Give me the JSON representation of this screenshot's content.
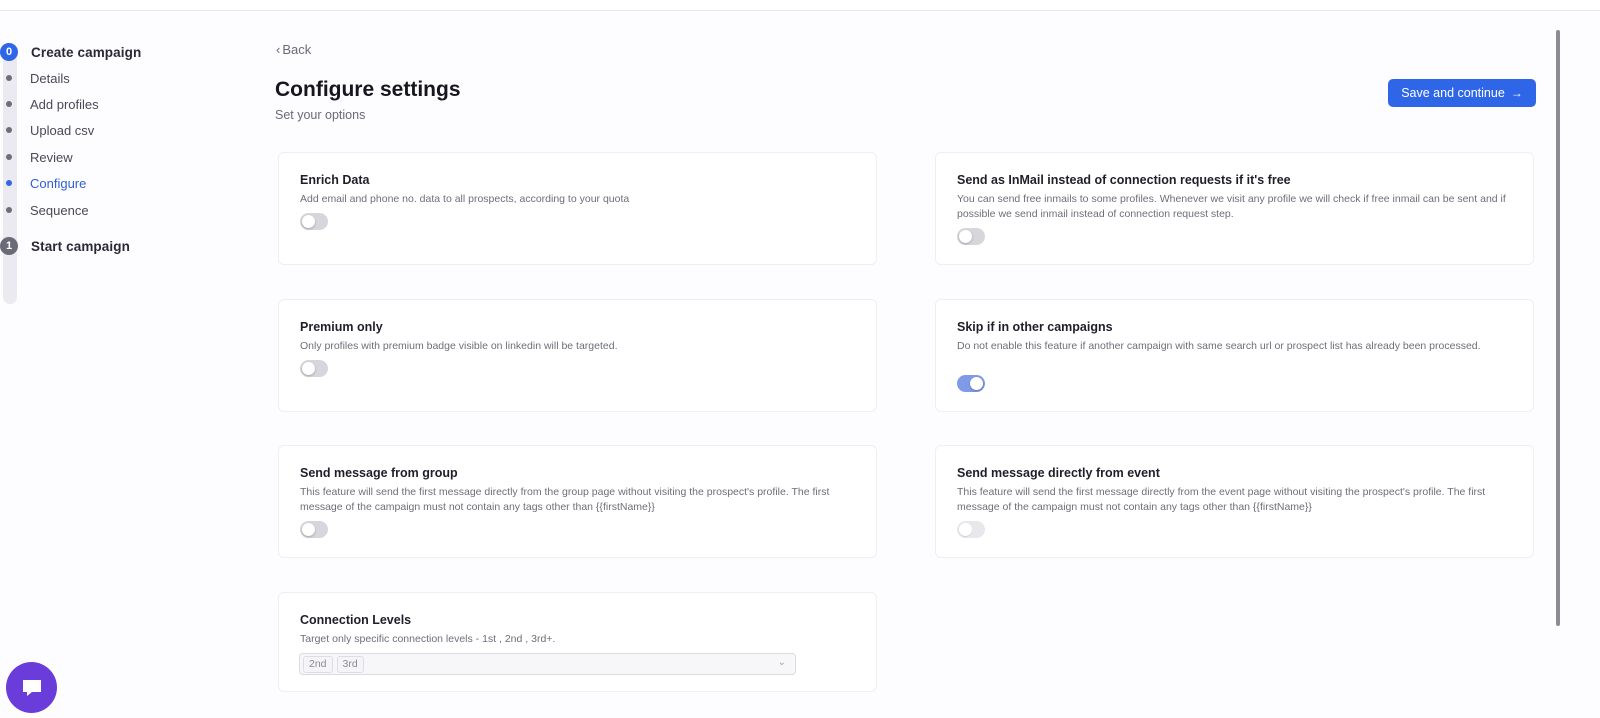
{
  "stepper": {
    "steps": [
      {
        "number": "0",
        "title": "Create campaign"
      },
      {
        "number": "1",
        "title": "Start campaign"
      }
    ],
    "substeps": [
      "Details",
      "Add profiles",
      "Upload csv",
      "Review",
      "Configure",
      "Sequence"
    ],
    "active_substep": "Configure"
  },
  "header": {
    "back_label": "Back",
    "title": "Configure settings",
    "subtitle": "Set your options",
    "save_label": "Save and continue"
  },
  "settings": [
    {
      "title": "Enrich Data",
      "description": "Add email and phone no. data to all prospects, according to your quota",
      "enabled": false
    },
    {
      "title": "Send as InMail instead of connection requests if it's free",
      "description": "You can send free inmails to some profiles. Whenever we visit any profile we will check if free inmail can be sent and if possible we send inmail instead of connection request step.",
      "enabled": false
    },
    {
      "title": "Premium only",
      "description": "Only profiles with premium badge visible on linkedin will be targeted.",
      "enabled": false
    },
    {
      "title": "Skip if in other campaigns",
      "description": "Do not enable this feature if another campaign with same search url or prospect list has already been processed.",
      "enabled": true
    },
    {
      "title": "Send message from group",
      "description": "This feature will send the first message directly from the group page without visiting the prospect's profile. The first message of the campaign must not contain any tags other than {{firstName}}",
      "enabled": false
    },
    {
      "title": "Send message directly from event",
      "description": "This feature will send the first message directly from the event page without visiting the prospect's profile. The first message of the campaign must not contain any tags other than {{firstName}}",
      "enabled": false,
      "disabled": true
    }
  ],
  "connection_levels": {
    "title": "Connection Levels",
    "description": "Target only specific connection levels - 1st , 2nd , 3rd+.",
    "selected": [
      "2nd",
      "3rd"
    ]
  },
  "colors": {
    "primary": "#2f66e8",
    "toggle_on": "#7f9be8",
    "chat": "#6a3cd9"
  }
}
